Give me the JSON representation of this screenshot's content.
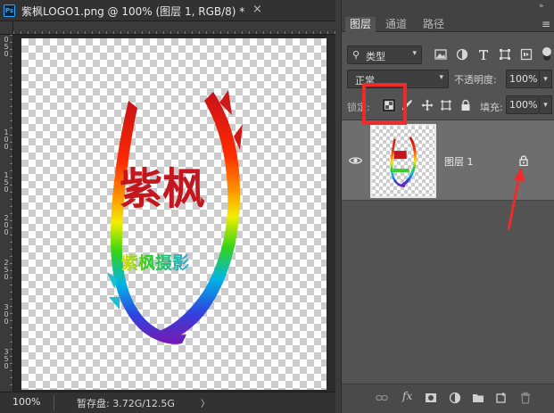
{
  "document": {
    "badge": "Ps",
    "title": "紫枫LOGO1.png @ 100% (图层 1, RGB/8) *",
    "close_glyph": "×",
    "ruler_left_ticks": [
      "0",
      "5",
      "0",
      "1",
      "0",
      "0",
      "1",
      "5",
      "0",
      "2",
      "0",
      "0",
      "2",
      "5",
      "0",
      "3",
      "0",
      "0",
      "3",
      "5",
      "0"
    ],
    "artwork_text_large": "紫枫",
    "artwork_text_small": "紫枫摄影",
    "zoom": "100%",
    "scratch": "暂存盘: 3.72G/12.5G",
    "status_arrow": "〉"
  },
  "panel": {
    "collapse_glyph": "»",
    "tabs": [
      {
        "label": "图层",
        "active": true
      },
      {
        "label": "通道",
        "active": false
      },
      {
        "label": "路径",
        "active": false
      }
    ],
    "menu_glyph": "≡",
    "filter": {
      "label": "类型",
      "search_icon": "search-icon"
    },
    "blend_mode": "正常",
    "opacity_label": "不透明度:",
    "opacity_value": "100%",
    "lock_label": "锁定:",
    "fill_label": "填充:",
    "fill_value": "100%",
    "layers": [
      {
        "name": "图层 1",
        "visible": true,
        "locked": true
      }
    ],
    "footer_fx": "fx"
  },
  "annotation_colors": {
    "box": "#ee2b2b",
    "arrow": "#ee2b2b"
  }
}
